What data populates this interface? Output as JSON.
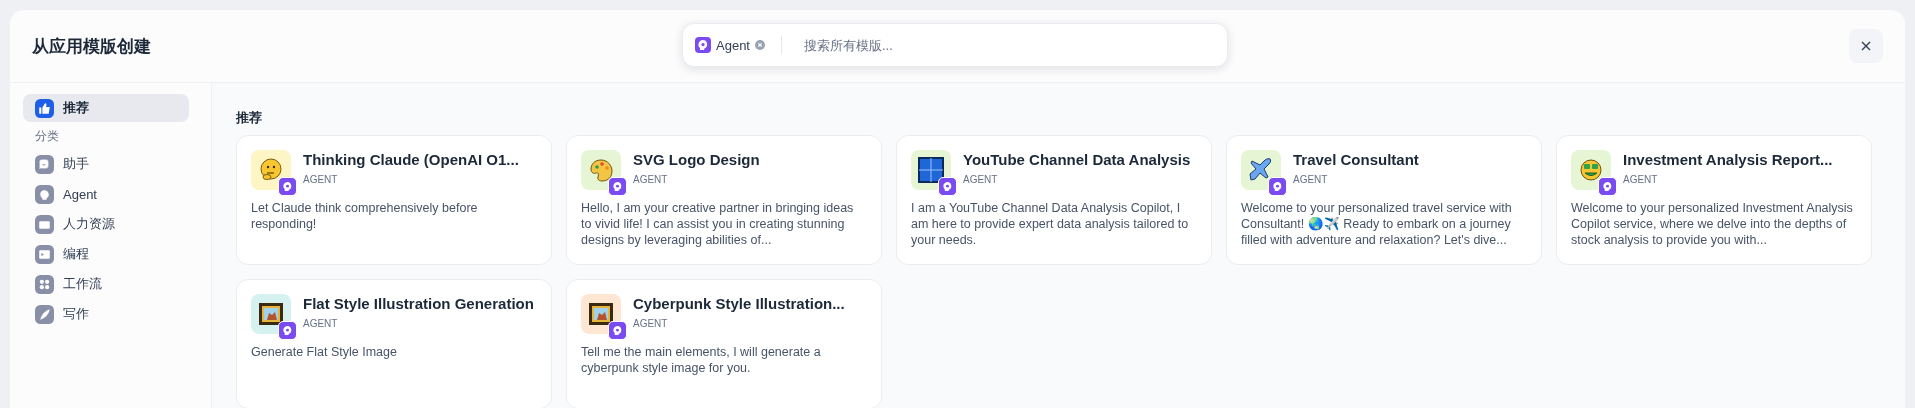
{
  "dialog": {
    "title": "从应用模版创建"
  },
  "search": {
    "chip": {
      "label": "Agent"
    },
    "placeholder": "搜索所有模版..."
  },
  "sidebar": {
    "top": {
      "label": "推荐",
      "selected": true
    },
    "heading": "分类",
    "items": [
      {
        "label": "助手",
        "kind": "assistant",
        "selected": false
      },
      {
        "label": "Agent",
        "kind": "agent",
        "selected": false
      },
      {
        "label": "人力资源",
        "kind": "hr",
        "selected": false
      },
      {
        "label": "编程",
        "kind": "code",
        "selected": false
      },
      {
        "label": "工作流",
        "kind": "workflow",
        "selected": false
      },
      {
        "label": "写作",
        "kind": "writing",
        "selected": false
      }
    ]
  },
  "section": {
    "title": "推荐"
  },
  "cards": [
    {
      "title": "Thinking Claude (OpenAI O1...",
      "tag": "AGENT",
      "kind": "thinking",
      "color": "#fdf5c4",
      "description": "Let Claude think comprehensively before responding!"
    },
    {
      "title": "SVG Logo Design",
      "tag": "AGENT",
      "kind": "palette",
      "color": "#e6f6d4",
      "description": "Hello, I am your creative partner in bringing ideas to vivid life! I can assist you in creating stunning designs by leveraging abilities of..."
    },
    {
      "title": "YouTube Channel Data Analysis",
      "tag": "AGENT",
      "kind": "grid",
      "color": "#e6f6d4",
      "description": "I am a YouTube Channel Data Analysis Copilot, I am here to provide expert data analysis tailored to your needs."
    },
    {
      "title": "Travel Consultant",
      "tag": "AGENT",
      "kind": "plane",
      "color": "#e6f6d4",
      "description": "Welcome to your personalized travel service with Consultant! 🌏✈️ Ready to embark on a journey filled with adventure and relaxation? Let's dive..."
    },
    {
      "title": "Investment Analysis Report...",
      "tag": "AGENT",
      "kind": "money",
      "color": "#e6f6d4",
      "description": "Welcome to your personalized Investment Analysis Copilot service, where we delve into the depths of stock analysis to provide you with..."
    },
    {
      "title": "Flat Style Illustration Generation",
      "tag": "AGENT",
      "kind": "frame",
      "color": "#d5f2f0",
      "description": "Generate Flat Style Image"
    },
    {
      "title": "Cyberpunk Style Illustration...",
      "tag": "AGENT",
      "kind": "frame",
      "color": "#fde6d2",
      "description": "Tell me the main elements, I will generate a cyberpunk style image for you."
    }
  ]
}
